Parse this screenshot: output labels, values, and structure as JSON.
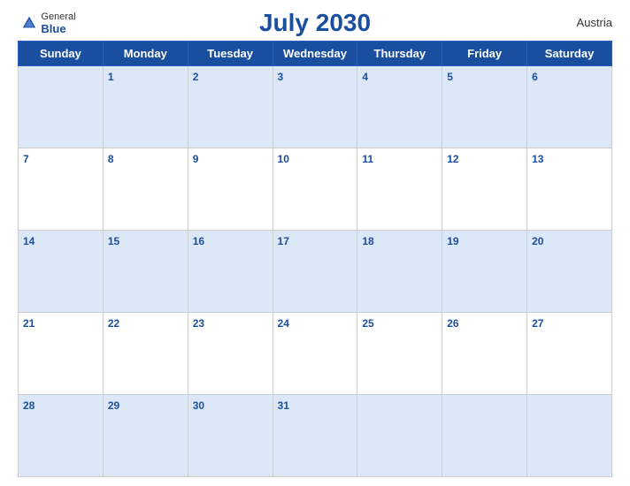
{
  "header": {
    "logo": {
      "general": "General",
      "blue": "Blue",
      "icon_color": "#1a4fa0"
    },
    "title": "July 2030",
    "country": "Austria"
  },
  "calendar": {
    "days_of_week": [
      "Sunday",
      "Monday",
      "Tuesday",
      "Wednesday",
      "Thursday",
      "Friday",
      "Saturday"
    ],
    "weeks": [
      [
        "",
        "1",
        "2",
        "3",
        "4",
        "5",
        "6"
      ],
      [
        "7",
        "8",
        "9",
        "10",
        "11",
        "12",
        "13"
      ],
      [
        "14",
        "15",
        "16",
        "17",
        "18",
        "19",
        "20"
      ],
      [
        "21",
        "22",
        "23",
        "24",
        "25",
        "26",
        "27"
      ],
      [
        "28",
        "29",
        "30",
        "31",
        "",
        "",
        ""
      ]
    ]
  }
}
